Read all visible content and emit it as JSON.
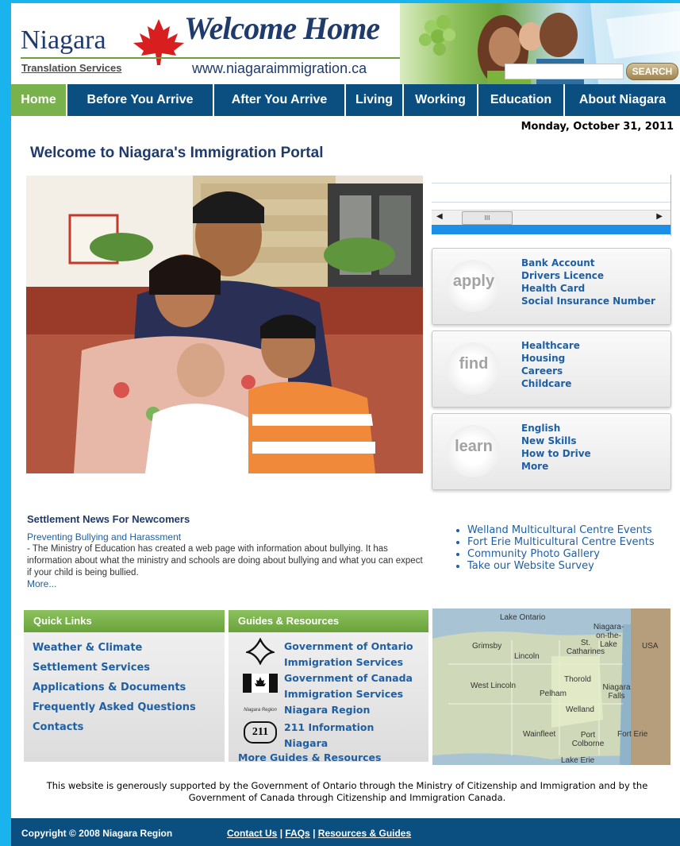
{
  "header": {
    "brand": "Niagara",
    "tagline": "Welcome Home",
    "translation_link": "Translation Services",
    "url": "www.niagaraimmigration.ca",
    "search": {
      "button_label": "SEARCH",
      "placeholder": ""
    }
  },
  "nav": {
    "items": [
      {
        "label": "Home"
      },
      {
        "label": "Before You Arrive"
      },
      {
        "label": "After You Arrive"
      },
      {
        "label": "Living"
      },
      {
        "label": "Working"
      },
      {
        "label": "Education"
      },
      {
        "label": "About Niagara"
      }
    ]
  },
  "date": "Monday, October 31, 2011",
  "page_title": "Welcome to Niagara's Immigration Portal",
  "scroll_widget": {
    "thumb_label": "III"
  },
  "cards": [
    {
      "word": "apply",
      "links": [
        "Bank Account",
        "Drivers Licence",
        "Health Card",
        "Social Insurance Number"
      ]
    },
    {
      "word": "find",
      "links": [
        "Healthcare",
        "Housing",
        "Careers",
        "Childcare"
      ]
    },
    {
      "word": "learn",
      "links": [
        "English",
        "New Skills",
        "How to Drive",
        "More"
      ]
    }
  ],
  "news": {
    "heading": "Settlement News For Newcomers",
    "link": "Preventing Bullying and Harassment",
    "body": "- The Ministry of Education has created a web page with information about bullying. It has information about what the ministry and schools are doing about bullying and what you can expect if your child is being bullied.",
    "more": "More..."
  },
  "events": [
    "Welland Multicultural Centre Events",
    "Fort Erie Multicultural Centre Events",
    "Community Photo Gallery",
    "Take our Website Survey"
  ],
  "quick_links": {
    "heading": "Quick Links",
    "items": [
      "Weather & Climate",
      "Settlement Services",
      "Applications & Documents",
      "Frequently Asked Questions",
      "Contacts"
    ]
  },
  "guides": {
    "heading": "Guides & Resources",
    "items": [
      {
        "line1": "Government of Ontario",
        "line2": "Immigration Services"
      },
      {
        "line1": "Government of Canada",
        "line2": "Immigration Services"
      },
      {
        "line1": "Niagara Region",
        "logo_text": "Niagara Region"
      },
      {
        "line1": "211 Information",
        "line2": "Niagara",
        "logo_text": "211"
      }
    ],
    "more": "More Guides & Resources"
  },
  "map": {
    "labels": [
      "Lake Ontario",
      "Niagara-on-the-Lake",
      "USA",
      "Grimsby",
      "Lincoln",
      "St. Catharines",
      "Thorold",
      "West Lincoln",
      "Pelham",
      "Niagara Falls",
      "Welland",
      "Wainfleet",
      "Port Colborne",
      "Fort Erie",
      "Lake Erie"
    ]
  },
  "support_text": "This website is generously supported by the Government of Ontario through the Ministry of Citizenship and Immigration and by the Government of Canada through Citizenship and Immigration Canada.",
  "footer": {
    "copyright": "Copyright © 2008 Niagara Region",
    "links": [
      "Contact Us",
      "FAQs",
      "Resources & Guides"
    ],
    "separator": "|"
  },
  "colors": {
    "nav_bg": "#0a4f80",
    "nav_active": "#79b24d",
    "link": "#1f5fa3",
    "title": "#1f3b6d",
    "frame": "#19b4ee"
  }
}
